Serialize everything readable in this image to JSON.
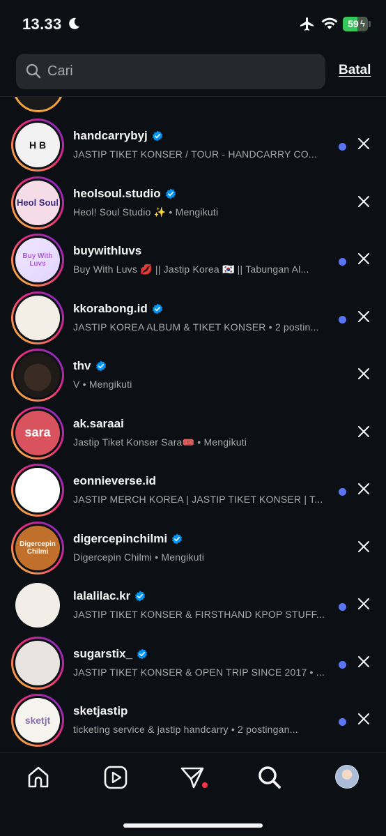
{
  "status_bar": {
    "time": "13.33",
    "battery": "59",
    "battery_level": 0.59,
    "icons": [
      "moon-icon",
      "airplane-icon",
      "wifi-icon",
      "battery-charging-icon"
    ]
  },
  "search": {
    "placeholder": "Cari",
    "value": "",
    "cancel_label": "Batal"
  },
  "results": [
    {
      "username": "handcarrybyj",
      "verified": true,
      "subtitle": "JASTIP TIKET KONSER / TOUR - HANDCARRY CO...",
      "unread": true,
      "avatar_style": "hb",
      "ring": true
    },
    {
      "username": "heolsoul.studio",
      "verified": true,
      "subtitle": "Heol! Soul Studio ✨ • Mengikuti",
      "unread": false,
      "avatar_style": "heol",
      "ring": true
    },
    {
      "username": "buywithluvs",
      "verified": false,
      "subtitle": "Buy With Luvs 💋 || Jastip Korea 🇰🇷 || Tabungan Al...",
      "unread": true,
      "avatar_style": "buy",
      "ring": true
    },
    {
      "username": "kkorabong.id",
      "verified": true,
      "subtitle": "JASTIP KOREA ALBUM & TIKET KONSER • 2 postin...",
      "unread": true,
      "avatar_style": "kko",
      "ring": true
    },
    {
      "username": "thv",
      "verified": true,
      "subtitle": "V • Mengikuti",
      "unread": false,
      "avatar_style": "thv",
      "ring": true
    },
    {
      "username": "ak.saraai",
      "verified": false,
      "subtitle": "Jastip Tiket Konser Sara🎟️ • Mengikuti",
      "unread": false,
      "avatar_style": "sara",
      "ring": true
    },
    {
      "username": "eonnieverse.id",
      "verified": false,
      "subtitle": "JASTIP MERCH KOREA | JASTIP TIKET KONSER | T...",
      "unread": true,
      "avatar_style": "eon",
      "ring": true
    },
    {
      "username": "digercepinchilmi",
      "verified": true,
      "subtitle": "Digercepin Chilmi • Mengikuti",
      "unread": false,
      "avatar_style": "dig",
      "ring": true
    },
    {
      "username": "lalalilac.kr",
      "verified": true,
      "subtitle": "JASTIP TIKET KONSER & FIRSTHAND KPOP STUFF...",
      "unread": true,
      "avatar_style": "lala",
      "ring": false
    },
    {
      "username": "sugarstix_",
      "verified": true,
      "subtitle": "JASTIP TIKET KONSER & OPEN TRIP SINCE 2017 • ...",
      "unread": true,
      "avatar_style": "sugar",
      "ring": true
    },
    {
      "username": "sketjastip",
      "verified": false,
      "subtitle": "ticketing service & jastip handcarry • 2 postingan...",
      "unread": true,
      "avatar_style": "sket",
      "ring": true
    }
  ],
  "avatar_text": {
    "hb": "H B",
    "heol": "Heol Soul",
    "buy": "Buy With Luvs",
    "sara": "sara",
    "dig": "Digercepin Chilmi",
    "sket": "sketjt"
  },
  "bottom_nav": {
    "items": [
      "home-icon",
      "reels-icon",
      "messages-icon",
      "search-icon",
      "profile-avatar"
    ],
    "active": "search-icon"
  },
  "colors": {
    "background": "#0c1014",
    "search_bg": "#25292e",
    "verified": "#0095f6",
    "unread_dot": "#5b74f5",
    "notification_dot": "#ff3040"
  }
}
